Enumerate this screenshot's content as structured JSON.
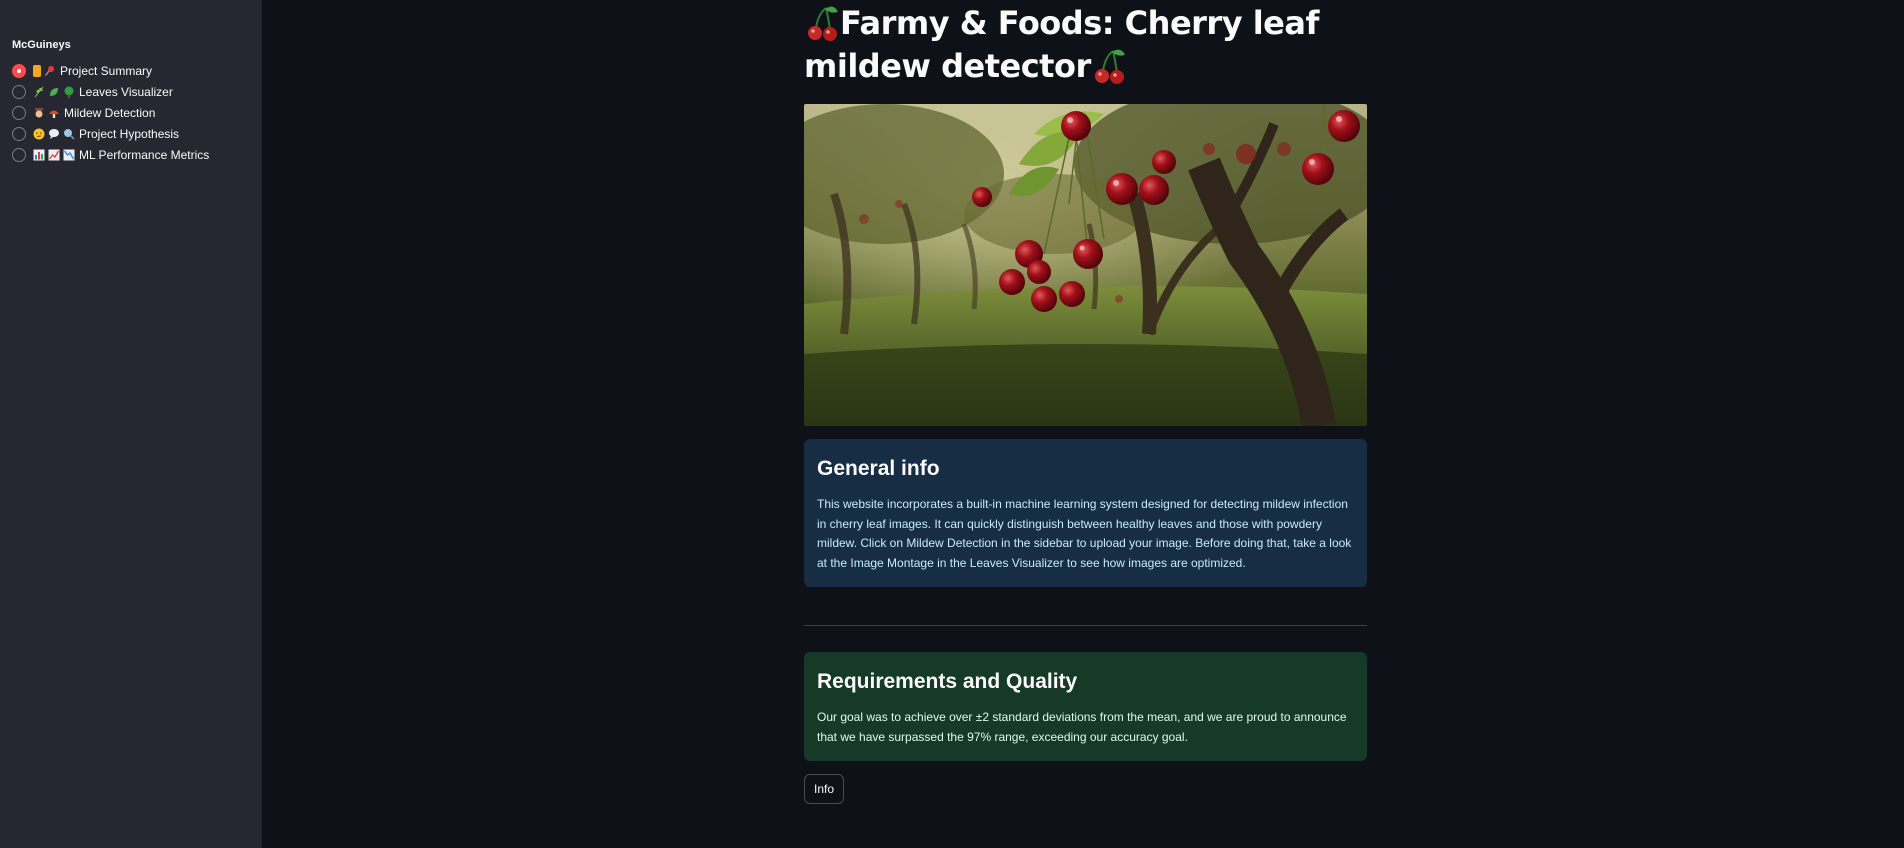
{
  "sidebar": {
    "title": "McGuineys",
    "items": [
      {
        "label": "Project Summary",
        "selected": true,
        "icons": [
          "bookmark-icon",
          "pushpin-icon"
        ]
      },
      {
        "label": "Leaves Visualizer",
        "selected": false,
        "icons": [
          "herb-icon",
          "leaf-icon",
          "tree-icon"
        ]
      },
      {
        "label": "Mildew Detection",
        "selected": false,
        "icons": [
          "detective-icon",
          "mushroom-icon"
        ]
      },
      {
        "label": "Project Hypothesis",
        "selected": false,
        "icons": [
          "thinking-face-icon",
          "speech-bubble-icon",
          "magnifier-icon"
        ]
      },
      {
        "label": "ML Performance Metrics",
        "selected": false,
        "icons": [
          "bar-chart-icon",
          "chart-up-icon",
          "chart-down-icon"
        ]
      }
    ]
  },
  "main": {
    "title": "Farmy & Foods: Cherry leaf mildew detector",
    "general_info": {
      "heading": "General info",
      "body": "This website incorporates a built-in machine learning system designed for detecting mildew infection in cherry leaf images. It can quickly distinguish between healthy leaves and those with powdery mildew. Click on Mildew Detection in the sidebar to upload your image. Before doing that, take a look at the Image Montage in the Leaves Visualizer to see how images are optimized."
    },
    "requirements": {
      "heading": "Requirements and Quality",
      "body": "Our goal was to achieve over ±2 standard deviations from the mean, and we are proud to announce that we have surpassed the 97% range, exceeding our accuracy goal."
    },
    "info_button": "Info"
  },
  "colors": {
    "accent": "#ff4b4b",
    "background": "#0e1117",
    "sidebar": "#262730",
    "info_box": "#172d43",
    "success_box": "#173928"
  }
}
